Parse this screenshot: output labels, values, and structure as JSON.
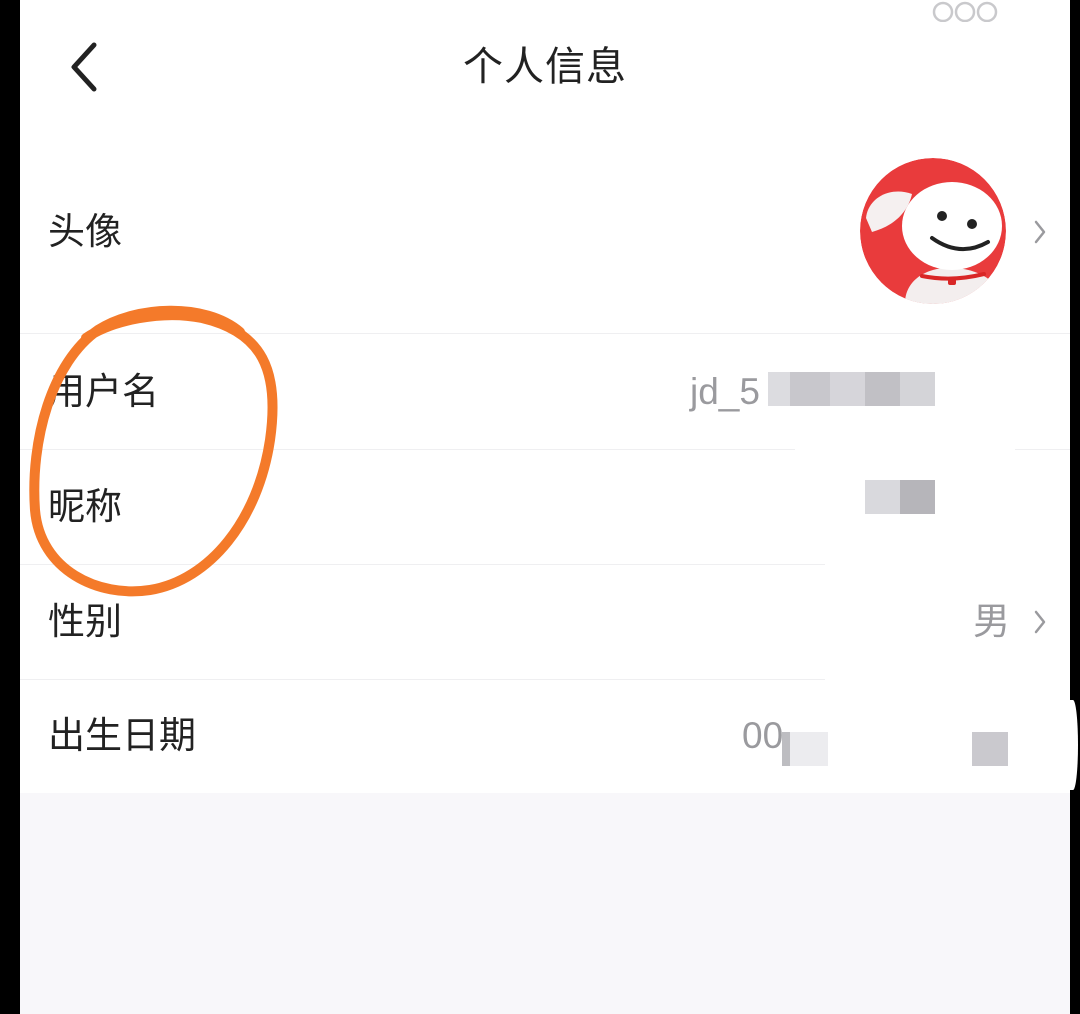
{
  "header": {
    "back_icon": "back-chevron-icon",
    "title": "个人信息",
    "more_icon": "more-dots-icon"
  },
  "rows": [
    {
      "label": "头像",
      "avatar_icon": "jd-mascot-avatar",
      "has_arrow": true
    },
    {
      "label": "用户名",
      "value": "jd_5",
      "redacted": true
    },
    {
      "label": "昵称",
      "redacted": true
    },
    {
      "label": "性别",
      "value": "男",
      "has_arrow": true
    },
    {
      "label": "出生日期",
      "value": "00",
      "redacted": true
    }
  ],
  "annotation": {
    "shape": "hand-drawn-circle",
    "encloses": [
      "用户名",
      "昵称"
    ]
  },
  "colors": {
    "text": "#222222",
    "secondary_text": "#9a9a9e",
    "divider": "#efeff1",
    "footer_background": "#f8f7fa",
    "avatar_red": "#e93b3c",
    "annotation_orange": "#f47a2a"
  }
}
